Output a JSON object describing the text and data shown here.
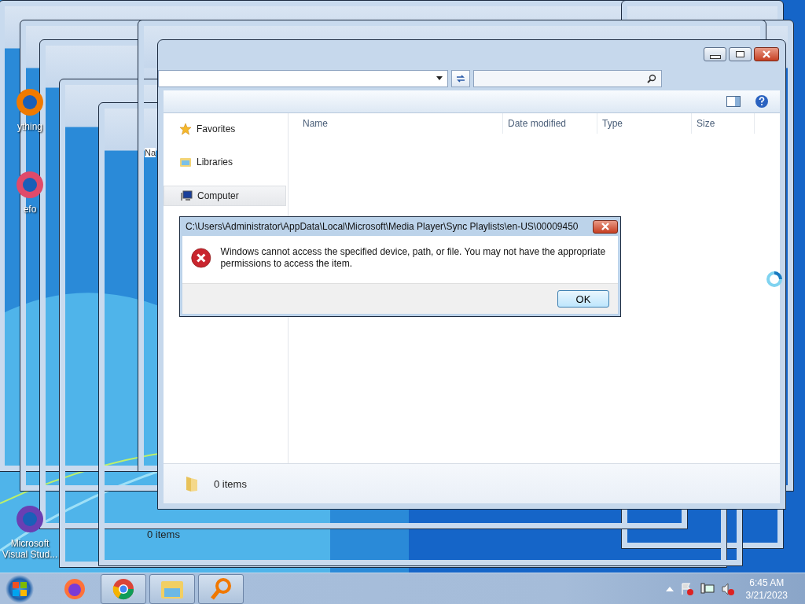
{
  "desktop_icons": [
    {
      "label": "ything"
    },
    {
      "label": "efo"
    },
    {
      "label": "Microsoft Visual Stud..."
    }
  ],
  "background_window": {
    "column_1": "Na",
    "status": "0 items"
  },
  "explorer": {
    "nav_items": [
      {
        "label": "Favorites",
        "kind": "star",
        "selected": false
      },
      {
        "label": "Libraries",
        "kind": "library",
        "selected": false
      },
      {
        "label": "Computer",
        "kind": "computer",
        "selected": true
      }
    ],
    "columns": [
      "Name",
      "Date modified",
      "Type",
      "Size"
    ],
    "status": "0 items"
  },
  "dialog": {
    "title": "C:\\Users\\Administrator\\AppData\\Local\\Microsoft\\Media Player\\Sync Playlists\\en-US\\00009450",
    "message": "Windows cannot access the specified device, path, or file.  You may not have the appropriate permissions to access the item.",
    "buttons": [
      "OK"
    ]
  },
  "taskbar": {
    "apps": [
      {
        "kind": "firefox",
        "selected": false
      },
      {
        "kind": "chrome",
        "selected": true
      },
      {
        "kind": "explorer",
        "selected": true
      },
      {
        "kind": "search",
        "selected": true
      }
    ],
    "time": "6:45 AM",
    "date": "3/21/2023"
  }
}
